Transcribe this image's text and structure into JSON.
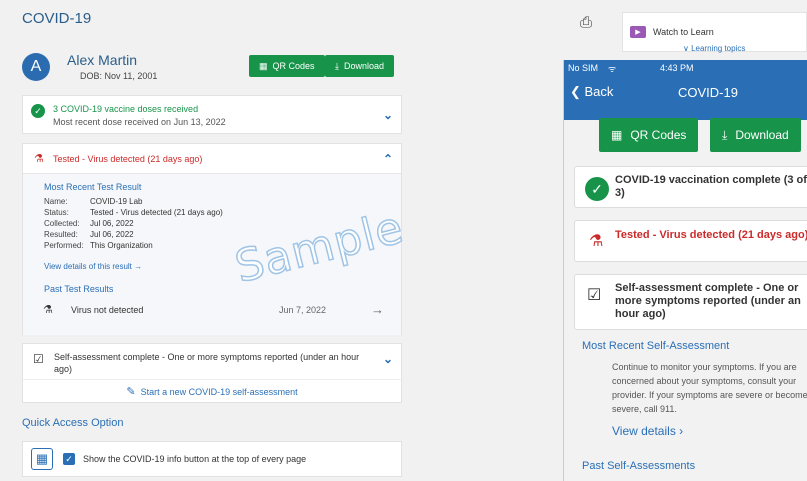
{
  "main": {
    "title": "COVID-19",
    "avatar_letter": "A",
    "patient_name": "Alex Martin",
    "dob": "DOB: Nov 11, 2001",
    "qr_button": "QR Codes",
    "download_button": "Download"
  },
  "vaccine": {
    "title": "3 COVID-19 vaccine doses received",
    "subtitle": "Most recent dose received on Jun 13, 2022"
  },
  "test": {
    "title": "Tested - Virus detected (21 days ago)",
    "recent_heading": "Most Recent Test Result",
    "rows": [
      {
        "label": "Name:",
        "value": "COVID-19 Lab"
      },
      {
        "label": "Status:",
        "value": "Tested - Virus detected (21 days ago)"
      },
      {
        "label": "Collected:",
        "value": "Jul 06, 2022"
      },
      {
        "label": "Resulted:",
        "value": "Jul 06, 2022"
      },
      {
        "label": "Performed:",
        "value": "This Organization"
      }
    ],
    "view_details": "View details of this result →",
    "past_heading": "Past Test Results",
    "past_item": "Virus not detected",
    "past_date": "Jun 7, 2022"
  },
  "watermark": "Sample",
  "self": {
    "title": "Self-assessment complete - One or more symptoms reported (under an hour ago)",
    "start": "Start a new COVID-19 self-assessment"
  },
  "quick": {
    "heading": "Quick Access Option",
    "checkbox_label": "Show the COVID-19 info button at the top of every page"
  },
  "side": {
    "watch": "Watch to Learn",
    "topics": "∨ Learning topics"
  },
  "phone": {
    "carrier": "No SIM",
    "time": "4:43 PM",
    "back": "Back",
    "title": "COVID-19",
    "qr": "QR Codes",
    "download": "Download",
    "vax": "COVID-19 vaccination complete (3 of 3)",
    "test": "Tested - Virus detected (21 days ago)",
    "self": "Self-assessment complete - One or more symptoms reported (under an hour ago)",
    "recent_heading": "Most Recent Self-Assessment",
    "body": "Continue to monitor your symptoms. If you are concerned about your symptoms, consult your provider. If your symptoms are severe or become severe, call 911.",
    "view": "View details",
    "past": "Past Self-Assessments"
  },
  "colors": {
    "primary": "#2a6fb6",
    "success": "#18944a",
    "danger": "#cc2a2a"
  }
}
